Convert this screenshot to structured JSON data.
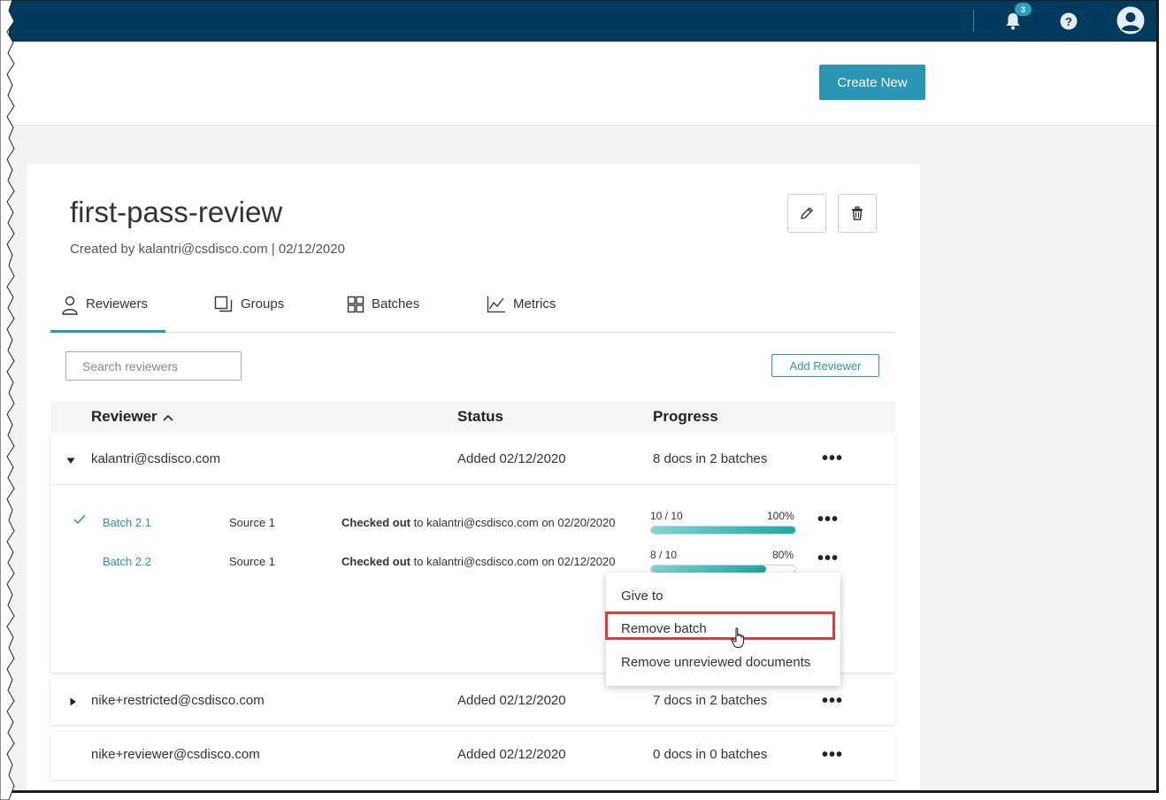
{
  "topbar": {
    "notifications_count": "3",
    "colors": {
      "bar": "#003a5d",
      "accent": "#2a95b4"
    }
  },
  "header": {
    "create_label": "Create New"
  },
  "review": {
    "title": "first-pass-review",
    "subtitle": "Created by kalantri@csdisco.com | 02/12/2020"
  },
  "tabs": [
    {
      "label": "Reviewers",
      "icon": "user-icon",
      "active": true
    },
    {
      "label": "Groups",
      "icon": "groups-icon",
      "active": false
    },
    {
      "label": "Batches",
      "icon": "grid-icon",
      "active": false
    },
    {
      "label": "Metrics",
      "icon": "line-chart-icon",
      "active": false
    }
  ],
  "search": {
    "placeholder": "Search reviewers"
  },
  "add_reviewer_label": "Add Reviewer",
  "table": {
    "headers": {
      "reviewer": "Reviewer",
      "status": "Status",
      "progress": "Progress"
    },
    "rows": [
      {
        "email": "kalantri@csdisco.com",
        "status": "Added 02/12/2020",
        "progress": "8 docs in 2 batches",
        "expanded": true
      },
      {
        "email": "nike+restricted@csdisco.com",
        "status": "Added 02/12/2020",
        "progress": "7 docs in 2 batches",
        "expanded": false
      },
      {
        "email": "nike+reviewer@csdisco.com",
        "status": "Added 02/12/2020",
        "progress": "0 docs in 0 batches",
        "expanded": false
      }
    ]
  },
  "batches": [
    {
      "name": "Batch 2.1",
      "source": "Source 1",
      "checked_label": "Checked out",
      "checked_rest": " to kalantri@csdisco.com on 02/20/2020",
      "count": "10 / 10",
      "percent": "100%",
      "fraction": 1.0,
      "complete": true
    },
    {
      "name": "Batch 2.2",
      "source": "Source 1",
      "checked_label": "Checked out",
      "checked_rest": " to kalantri@csdisco.com on 02/12/2020",
      "count": "8 / 10",
      "percent": "80%",
      "fraction": 0.8,
      "complete": false
    }
  ],
  "context_menu": {
    "items": [
      "Give to",
      "Remove batch",
      "Remove unreviewed documents"
    ],
    "highlighted": "Remove batch"
  }
}
